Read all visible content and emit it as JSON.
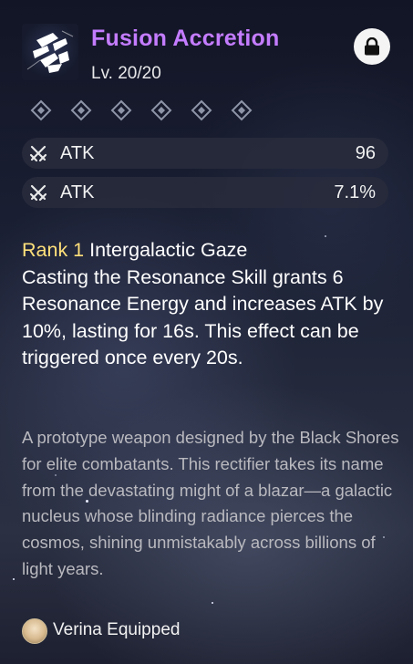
{
  "weapon": {
    "name": "Fusion Accretion",
    "level": "Lv. 20/20",
    "icon": "weapon-rectifier-icon",
    "lock_icon": "lock-icon",
    "rank_slots": 6
  },
  "stats": [
    {
      "icon": "crossed-swords-icon",
      "name": "ATK",
      "value": "96"
    },
    {
      "icon": "crossed-swords-icon",
      "name": "ATK",
      "value": "7.1%"
    }
  ],
  "effect": {
    "rank_label": "Rank 1",
    "title": " Intergalactic Gaze",
    "description": "Casting the Resonance Skill grants 6 Resonance Energy and increases ATK by 10%, lasting for 16s. This effect can be triggered once every 20s."
  },
  "lore": "A prototype weapon designed by the Black Shores for elite combatants. This rectifier takes its name from the devastating might of a blazar—a galactic nucleus whose blinding radiance pierces the cosmos, shining unmistakably across billions of light years.",
  "equipped": {
    "text": "Verina Equipped",
    "avatar": "verina-avatar"
  },
  "colors": {
    "title": "#c47cff",
    "rank_label": "#ffe07a",
    "lore_text": "#b9b9bf"
  }
}
